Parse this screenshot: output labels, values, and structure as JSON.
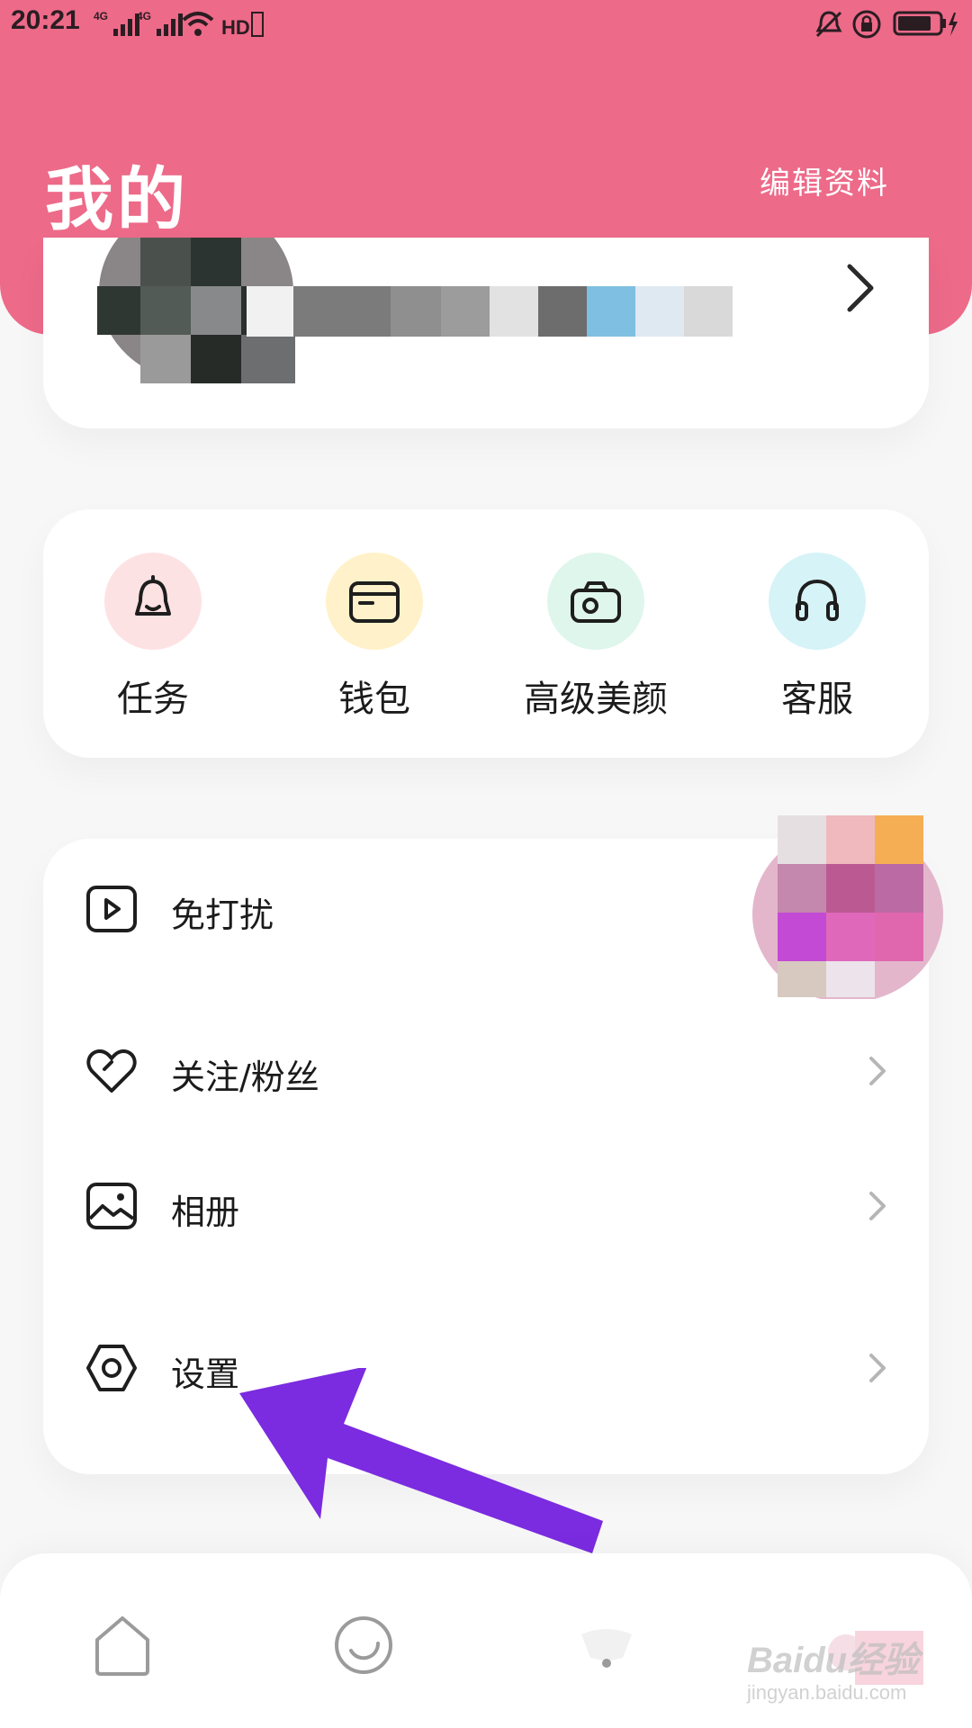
{
  "status_bar": {
    "time": "20:21",
    "network_left": "4G",
    "network_right": "4G",
    "hd_label": "HD"
  },
  "header": {
    "title": "我的",
    "edit_profile": "编辑资料",
    "color": "#ed6a89"
  },
  "shortcuts": [
    {
      "label": "任务",
      "icon": "bell-icon",
      "color": "#fde2e4"
    },
    {
      "label": "钱包",
      "icon": "wallet-icon",
      "color": "#fff1c9"
    },
    {
      "label": "高级美颜",
      "icon": "camera-icon",
      "color": "#dff6ec"
    },
    {
      "label": "客服",
      "icon": "headset-icon",
      "color": "#d6f3f7"
    }
  ],
  "menu": [
    {
      "label": "免打扰",
      "icon": "play-square-icon"
    },
    {
      "label": "关注/粉丝",
      "icon": "heart-icon"
    },
    {
      "label": "相册",
      "icon": "image-icon"
    },
    {
      "label": "设置",
      "icon": "hexagon-gear-icon"
    }
  ],
  "annotation": {
    "color": "#7b2be0"
  },
  "watermark": {
    "brand": "Baidu经验",
    "url": "jingyan.baidu.com"
  }
}
